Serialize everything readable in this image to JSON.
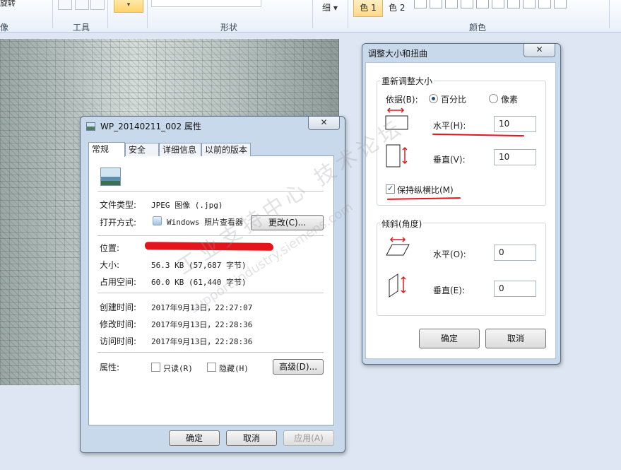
{
  "ribbon": {
    "groups": {
      "image_fragment": "像",
      "tools": "工具",
      "shapes": "形状",
      "colors": "颜色"
    },
    "rotate_fragment": "旋转",
    "size_label": "细",
    "color1_label": "色 1",
    "color2_label": "色 2"
  },
  "properties": {
    "title": "WP_20140211_002 属性",
    "close_label": "✕",
    "tabs": [
      "常规",
      "安全",
      "详细信息",
      "以前的版本"
    ],
    "rows": {
      "file_type_label": "文件类型:",
      "file_type_value": "JPEG 图像 (.jpg)",
      "opens_with_label": "打开方式:",
      "opens_with_value": "Windows 照片查看器",
      "change_button": "更改(C)...",
      "location_label": "位置:",
      "size_label": "大小:",
      "size_value": "56.3 KB (57,687 字节)",
      "disk_size_label": "占用空间:",
      "disk_size_value": "60.0 KB (61,440 字节)",
      "created_label": "创建时间:",
      "created_value": "2017年9月13日，22:27:07",
      "modified_label": "修改时间:",
      "modified_value": "2017年9月13日，22:28:36",
      "accessed_label": "访问时间:",
      "accessed_value": "2017年9月13日，22:28:36",
      "attributes_label": "属性:",
      "readonly_label": "只读(R)",
      "hidden_label": "隐藏(H)",
      "advanced_button": "高级(D)..."
    },
    "buttons": {
      "ok": "确定",
      "cancel": "取消",
      "apply": "应用(A)"
    }
  },
  "resize": {
    "title": "调整大小和扭曲",
    "close_label": "✕",
    "resize_group": "重新调整大小",
    "by_label": "依据(B):",
    "percent_label": "百分比",
    "pixels_label": "像素",
    "percent_selected": true,
    "horizontal_label": "水平(H):",
    "horizontal_value": "10",
    "vertical_label": "垂直(V):",
    "vertical_value": "10",
    "keep_ratio_label": "保持纵横比(M)",
    "keep_ratio_checked": true,
    "skew_group": "倾斜(角度)",
    "skew_h_label": "水平(O):",
    "skew_h_value": "0",
    "skew_v_label": "垂直(E):",
    "skew_v_value": "0",
    "ok": "确定",
    "cancel": "取消"
  },
  "colors": {
    "annotation_red": "#e4141d",
    "accent_yellow": "#ffd36b"
  }
}
